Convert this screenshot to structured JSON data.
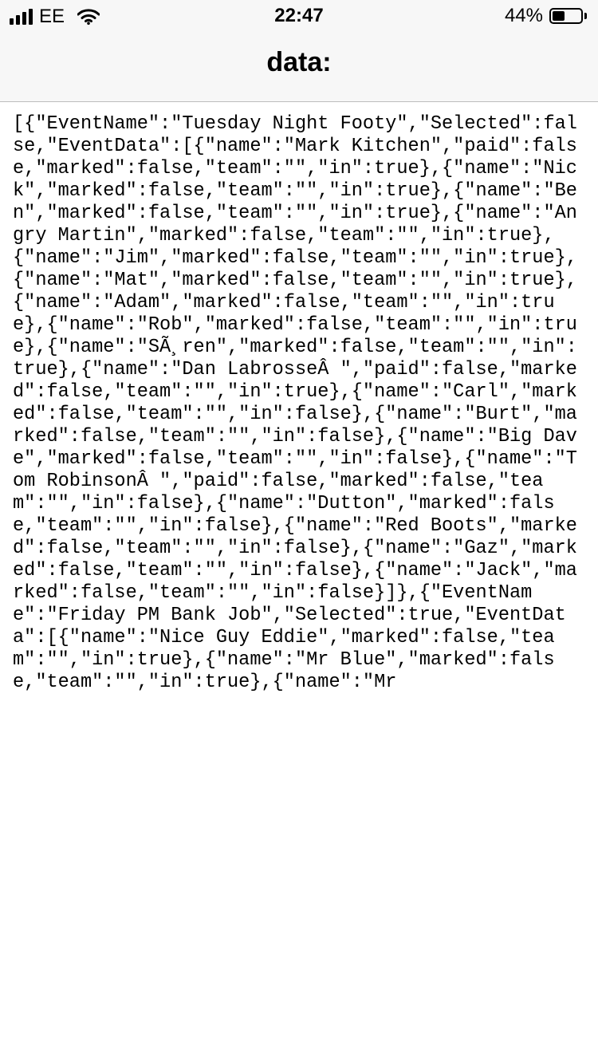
{
  "status_bar": {
    "carrier": "EE",
    "time": "22:47",
    "battery_percent": "44%",
    "battery_level": 0.44,
    "signal_bars": 4
  },
  "nav": {
    "title": "data:"
  },
  "content": {
    "text": "[{\"EventName\":\"Tuesday Night Footy\",\"Selected\":false,\"EventData\":[{\"name\":\"Mark Kitchen\",\"paid\":false,\"marked\":false,\"team\":\"\",\"in\":true},{\"name\":\"Nick\",\"marked\":false,\"team\":\"\",\"in\":true},{\"name\":\"Ben\",\"marked\":false,\"team\":\"\",\"in\":true},{\"name\":\"Angry Martin\",\"marked\":false,\"team\":\"\",\"in\":true},{\"name\":\"Jim\",\"marked\":false,\"team\":\"\",\"in\":true},{\"name\":\"Mat\",\"marked\":false,\"team\":\"\",\"in\":true},{\"name\":\"Adam\",\"marked\":false,\"team\":\"\",\"in\":true},{\"name\":\"Rob\",\"marked\":false,\"team\":\"\",\"in\":true},{\"name\":\"SÃ¸ren\",\"marked\":false,\"team\":\"\",\"in\":true},{\"name\":\"Dan LabrosseÂ \",\"paid\":false,\"marked\":false,\"team\":\"\",\"in\":true},{\"name\":\"Carl\",\"marked\":false,\"team\":\"\",\"in\":false},{\"name\":\"Burt\",\"marked\":false,\"team\":\"\",\"in\":false},{\"name\":\"Big Dave\",\"marked\":false,\"team\":\"\",\"in\":false},{\"name\":\"Tom RobinsonÂ \",\"paid\":false,\"marked\":false,\"team\":\"\",\"in\":false},{\"name\":\"Dutton\",\"marked\":false,\"team\":\"\",\"in\":false},{\"name\":\"Red Boots\",\"marked\":false,\"team\":\"\",\"in\":false},{\"name\":\"Gaz\",\"marked\":false,\"team\":\"\",\"in\":false},{\"name\":\"Jack\",\"marked\":false,\"team\":\"\",\"in\":false}]},{\"EventName\":\"Friday PM Bank Job\",\"Selected\":true,\"EventData\":[{\"name\":\"Nice Guy Eddie\",\"marked\":false,\"team\":\"\",\"in\":true},{\"name\":\"Mr Blue\",\"marked\":false,\"team\":\"\",\"in\":true},{\"name\":\"Mr"
  }
}
